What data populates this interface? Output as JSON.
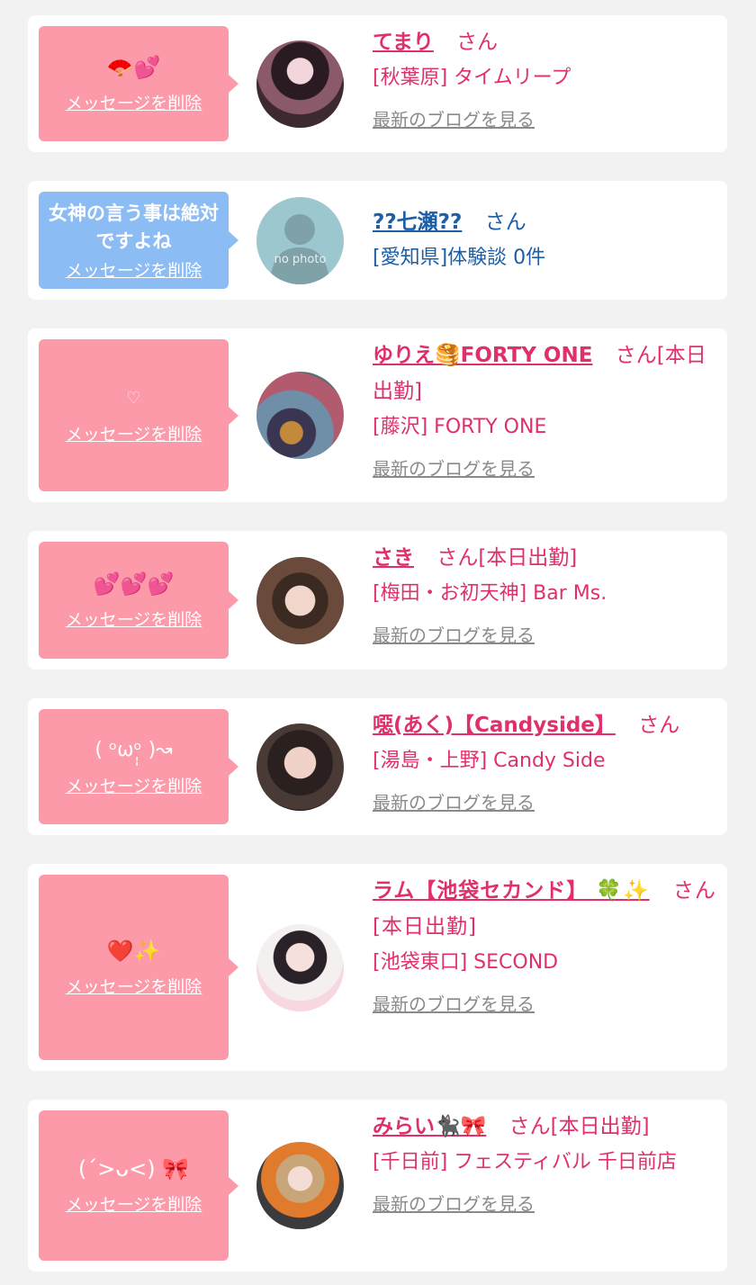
{
  "cards": [
    {
      "message": "🪭💕",
      "delete_label": "メッセージを削除",
      "name": "てまり",
      "suffix": "さん",
      "shop": "[秋葉原] タイムリープ",
      "blog": "最新のブログを見る"
    },
    {
      "message": "女神の言う事は絶対ですよね",
      "delete_label": "メッセージを削除",
      "name": "??七瀬??",
      "suffix": "さん",
      "shop": "[愛知県]体験談 0件",
      "avatar_text": "no photo"
    },
    {
      "message": "♡",
      "delete_label": "メッセージを削除",
      "name": "ゆりえ🥞FORTY ONE",
      "suffix": "さん[本日出勤]",
      "shop": "[藤沢] FORTY ONE",
      "blog": "最新のブログを見る"
    },
    {
      "message": "💕💕💕",
      "delete_label": "メッセージを削除",
      "name": "さき",
      "suffix": "さん[本日出勤]",
      "shop": "[梅田・お初天神] Bar Ms.",
      "blog": "最新のブログを見る"
    },
    {
      "message": "( ᵒωᵒ̩̩ )↝",
      "delete_label": "メッセージを削除",
      "name": "噁(あく)【Candyside】",
      "suffix": "さん",
      "shop": "[湯島・上野] Candy Side",
      "blog": "最新のブログを見る"
    },
    {
      "message": "❤️✨",
      "delete_label": "メッセージを削除",
      "name": "ラム【池袋セカンド】 🍀✨",
      "suffix": "さん[本日出勤]",
      "shop": "[池袋東口] SECOND",
      "blog": "最新のブログを見る"
    },
    {
      "message": "(ˊ>ᴗ<) 🎀",
      "delete_label": "メッセージを削除",
      "name": "みらい🐈‍⬛🎀",
      "suffix": "さん[本日出勤]",
      "shop": "[千日前] フェスティバル 千日前店",
      "blog": "最新のブログを見る"
    }
  ],
  "colors": {
    "pink_bubble": "#fd9aaa",
    "blue_bubble": "#8cbcf4",
    "accent": "#e0306a",
    "blue_text": "#1c5fa6"
  }
}
